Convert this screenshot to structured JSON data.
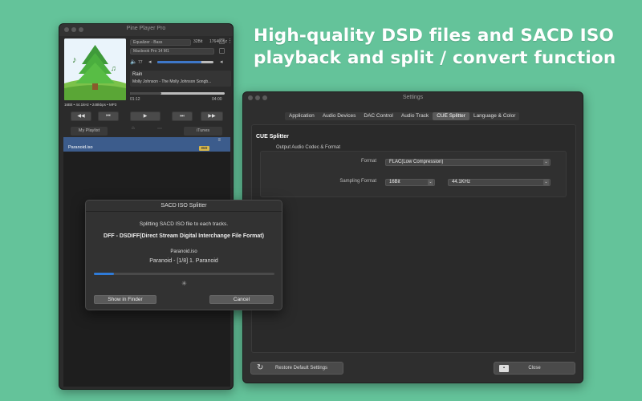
{
  "headline": {
    "line1": "High-quality DSD files and SACD ISO",
    "line2": "playback and split / convert function"
  },
  "player": {
    "title": "Pine Player Pro",
    "output_device": "Equalizer - Bass",
    "bit_depth": "32Bit",
    "sample_rate": "176400hz",
    "device_name": "Macbook Pro 14 M1",
    "volume_level": "77",
    "track": {
      "title": "Rain",
      "artist_album": "Molly Johnson - The Molly Johnson Songb..."
    },
    "format_info": "16Bit • 44.1kHz • 248kbps • MP3",
    "progress": 0.33,
    "time_elapsed": "01:12",
    "time_total": "04:00",
    "controls": {
      "rewind": "◀◀",
      "prev": "⏮",
      "play": "▶",
      "next": "⏭",
      "forward": "▶▶"
    },
    "tabs": {
      "my_playlist": "My Playlist",
      "itunes": "iTunes"
    },
    "playlist_items": [
      {
        "name": "Paranoid.iso",
        "badge": "ISO"
      }
    ]
  },
  "settings": {
    "title": "Settings",
    "tabs": [
      "Application",
      "Audio Devices",
      "DAC Control",
      "Audio Track",
      "CUE Splitter",
      "Language & Color"
    ],
    "active_tab": "CUE Splitter",
    "section_title": "CUE Splitter",
    "group_label": "Output Audio Codec & Format",
    "format_label": "Format",
    "format_value": "FLAC(Low Compression)",
    "sampling_label": "Sampling Format",
    "sampling_bits": "16Bit",
    "sampling_rate": "44.1KHz",
    "restore_label": "Restore Default Settings",
    "close_label": "Close"
  },
  "dialog": {
    "title": "SACD ISO Splitter",
    "message": "Splitting SACD ISO file to each tracks.",
    "format_line": "DFF - DSDIFF(Direct Stream Digital Interchange File Format)",
    "file_name": "Paranoid.iso",
    "current_track": "Paranoid - [1/8] 1. Paranoid",
    "progress": 0.11,
    "show_in_finder": "Show in Finder",
    "cancel": "Cancel"
  },
  "colors": {
    "background": "#64c39a",
    "accent_blue": "#2f7bd8",
    "playlist_highlight": "#3c5c8c",
    "iso_badge": "#d9b84a"
  }
}
